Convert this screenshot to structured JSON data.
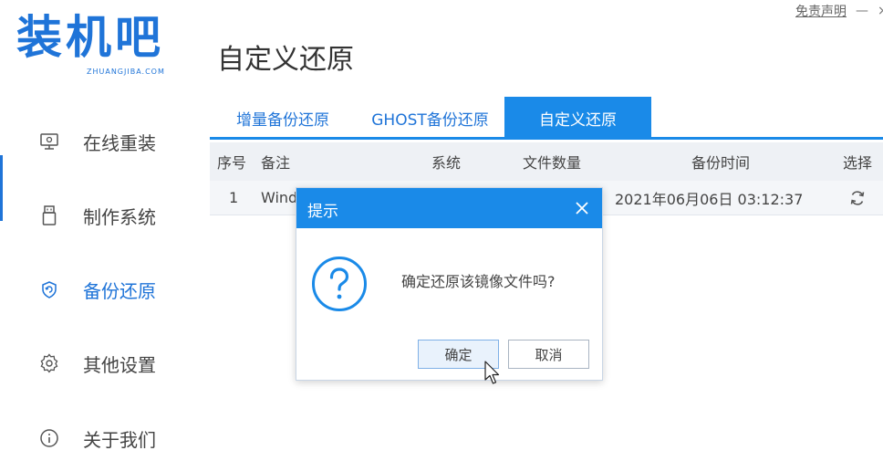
{
  "window": {
    "disclaimer": "免责声明",
    "minimize": "—",
    "close": "×"
  },
  "logo": {
    "main": "装机吧",
    "sub": "ZHUANGJIBA.COM"
  },
  "page_title": "自定义还原",
  "sidebar": {
    "items": [
      {
        "label": "在线重装",
        "icon": "monitor-icon"
      },
      {
        "label": "制作系统",
        "icon": "usb-icon"
      },
      {
        "label": "备份还原",
        "icon": "backup-restore-icon",
        "active": true
      },
      {
        "label": "其他设置",
        "icon": "gear-icon"
      },
      {
        "label": "关于我们",
        "icon": "info-icon"
      }
    ]
  },
  "tabs": [
    {
      "label": "增量备份还原"
    },
    {
      "label": "GHOST备份还原"
    },
    {
      "label": "自定义还原",
      "active": true
    }
  ],
  "table": {
    "columns": [
      "序号",
      "备注",
      "系统",
      "文件数量",
      "备份时间",
      "选择"
    ],
    "rows": [
      {
        "seq": "1",
        "note": "Wind",
        "system": "",
        "count": "",
        "time": "2021年06月06日 03:12:37",
        "choice_icon": "restore-icon"
      }
    ]
  },
  "dialog": {
    "title": "提示",
    "message": "确定还原该镜像文件吗?",
    "ok": "确定",
    "cancel": "取消",
    "icon": "question-icon"
  },
  "colors": {
    "accent": "#1a8ae8",
    "logo": "#1f74d8"
  }
}
